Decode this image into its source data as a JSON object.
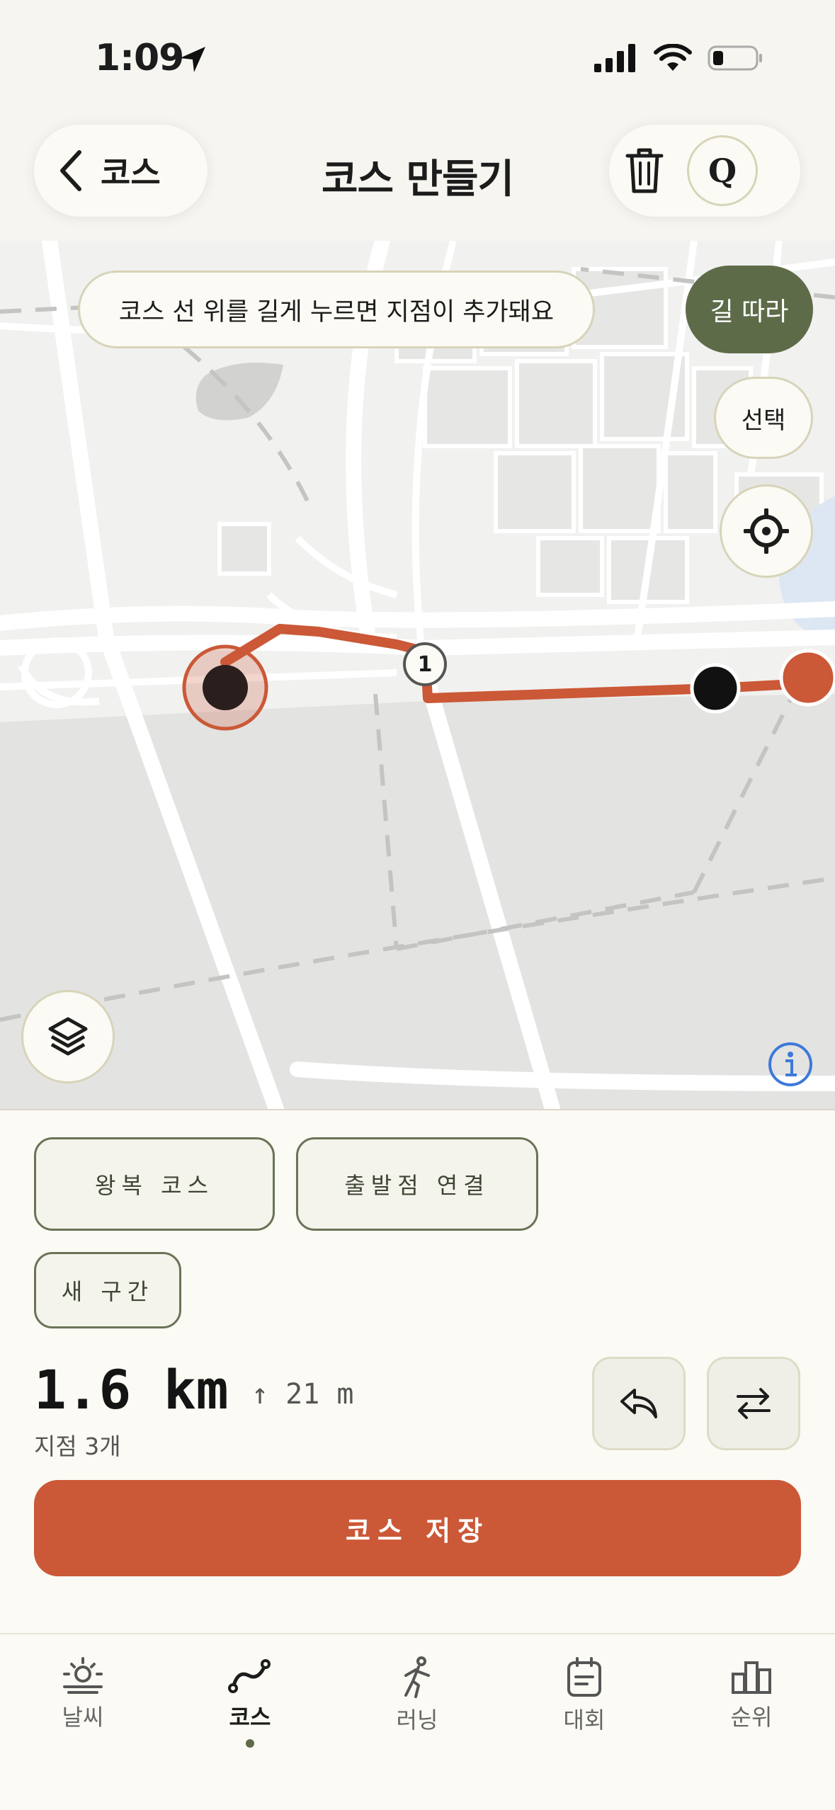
{
  "status_bar": {
    "time": "1:09"
  },
  "header": {
    "back_label": "코스",
    "title": "코스 만들기",
    "q_label": "Q"
  },
  "map": {
    "hint": "코스 선 위를 길게 누르면 지점이 추가돼요",
    "follow_road_label": "길 따라",
    "select_label": "선택",
    "waypoint_number": "1",
    "route_color": "#cb5836"
  },
  "sheet": {
    "roundtrip_label": "왕복 코스",
    "connect_label": "출발점 연결",
    "new_segment_label": "새 구간",
    "distance": "1.6 km",
    "elevation": "↑ 21 m",
    "points": "지점 3개",
    "save_label": "코스 저장"
  },
  "tabs": [
    {
      "label": "날씨",
      "icon": "sun-icon",
      "active": false
    },
    {
      "label": "코스",
      "icon": "route-icon",
      "active": true
    },
    {
      "label": "러닝",
      "icon": "runner-icon",
      "active": false
    },
    {
      "label": "대회",
      "icon": "calendar-icon",
      "active": false
    },
    {
      "label": "순위",
      "icon": "podium-icon",
      "active": false
    }
  ],
  "colors": {
    "accent": "#cb5836",
    "olive": "#5e6b49",
    "background": "#fbfaf4"
  }
}
